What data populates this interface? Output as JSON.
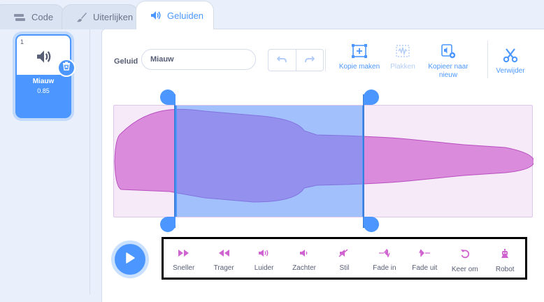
{
  "tabs": [
    {
      "label": "Code",
      "icon": "code-icon"
    },
    {
      "label": "Uiterlijken",
      "icon": "brush-icon"
    },
    {
      "label": "Geluiden",
      "icon": "speaker-icon",
      "active": true
    }
  ],
  "sound_list": {
    "items": [
      {
        "index": "1",
        "name": "Miauw",
        "duration": "0.85",
        "icon": "speaker-icon",
        "selected": true
      }
    ]
  },
  "editor": {
    "name_label": "Geluid",
    "name_value": "Miauw",
    "toolbar": {
      "copy_label": "Kopie maken",
      "paste_label": "Plakken",
      "copy_new_label": "Kopieer naar nieuw",
      "delete_label": "Verwijder"
    },
    "effects": [
      {
        "label": "Sneller",
        "icon": "faster-icon"
      },
      {
        "label": "Trager",
        "icon": "slower-icon"
      },
      {
        "label": "Luider",
        "icon": "louder-icon"
      },
      {
        "label": "Zachter",
        "icon": "softer-icon"
      },
      {
        "label": "Stil",
        "icon": "mute-icon"
      },
      {
        "label": "Fade in",
        "icon": "fade-in-icon"
      },
      {
        "label": "Fade uit",
        "icon": "fade-out-icon"
      },
      {
        "label": "Keer om",
        "icon": "reverse-icon"
      },
      {
        "label": "Robot",
        "icon": "robot-icon"
      }
    ]
  },
  "colors": {
    "accent": "#4c97ff",
    "effect_icon": "#cf63cf",
    "waveform": "#cf63cf",
    "waveform_bg": "#f6e9f8"
  }
}
